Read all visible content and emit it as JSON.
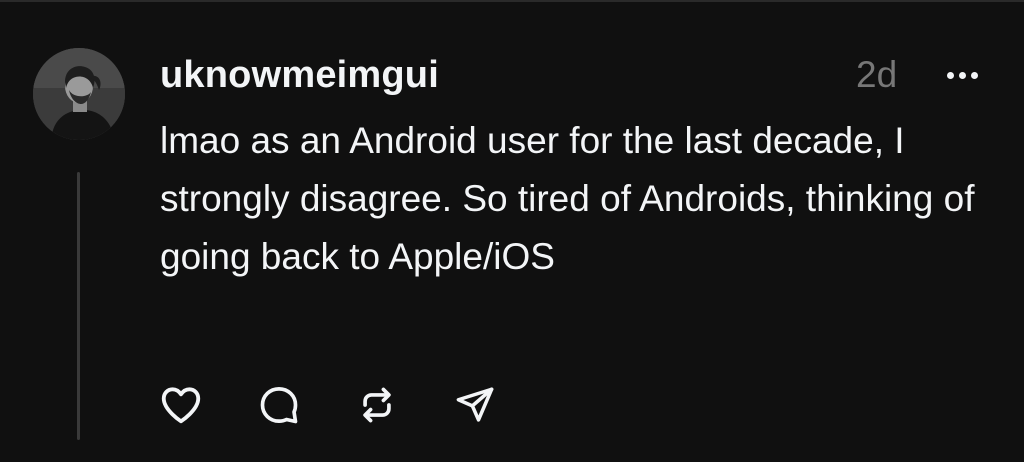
{
  "post": {
    "username": "uknowmeimgui",
    "timestamp": "2d",
    "body": "lmao as an Android user for the last decade, I strongly disagree. So tired of Androids, thinking of going back to Apple/iOS",
    "more_icon": "more-horizontal-icon"
  },
  "actions": {
    "like_icon": "heart-icon",
    "reply_icon": "comment-icon",
    "repost_icon": "repost-icon",
    "share_icon": "send-icon"
  },
  "colors": {
    "background": "#101010",
    "text": "#f3f5f7",
    "muted": "#777777",
    "thread_line": "#3a3a3a"
  }
}
